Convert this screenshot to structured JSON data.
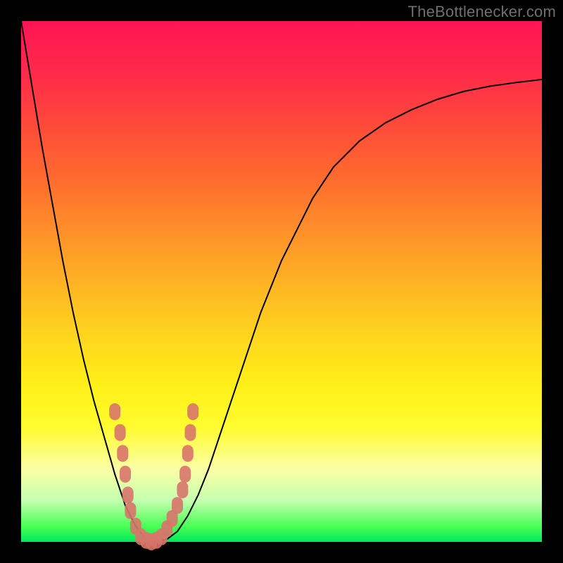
{
  "watermark": "TheBottlenecker.com",
  "colors": {
    "curve_stroke": "#000000",
    "node_fill": "#d8746a",
    "node_fill_alpha": 0.9
  },
  "chart_data": {
    "type": "line",
    "title": "",
    "xlabel": "",
    "ylabel": "",
    "xlim": [
      0,
      100
    ],
    "ylim": [
      0,
      100
    ],
    "x": [
      0,
      2,
      4,
      6,
      8,
      10,
      12,
      14,
      16,
      18,
      20,
      22,
      24,
      26,
      28,
      30,
      32,
      34,
      36,
      38,
      40,
      42,
      44,
      46,
      48,
      50,
      52,
      54,
      56,
      58,
      60,
      65,
      70,
      75,
      80,
      85,
      90,
      95,
      100
    ],
    "y": [
      100,
      88,
      76,
      65,
      54,
      44,
      35,
      27,
      20,
      13,
      7,
      3,
      0.5,
      0,
      0.5,
      2,
      5,
      9,
      14,
      20,
      26,
      32,
      38,
      44,
      49,
      54,
      58,
      62,
      66,
      69,
      72,
      77,
      80.5,
      83,
      85,
      86.5,
      87.5,
      88.2,
      88.8
    ],
    "annotated_nodes": [
      {
        "x": 18,
        "y": 25
      },
      {
        "x": 19,
        "y": 21
      },
      {
        "x": 19.5,
        "y": 17
      },
      {
        "x": 20,
        "y": 13
      },
      {
        "x": 20.5,
        "y": 9
      },
      {
        "x": 21,
        "y": 6
      },
      {
        "x": 22,
        "y": 3
      },
      {
        "x": 23,
        "y": 1
      },
      {
        "x": 24,
        "y": 0.3
      },
      {
        "x": 25,
        "y": 0
      },
      {
        "x": 26,
        "y": 0.3
      },
      {
        "x": 27,
        "y": 1
      },
      {
        "x": 28,
        "y": 2.5
      },
      {
        "x": 29,
        "y": 4.5
      },
      {
        "x": 30,
        "y": 7
      },
      {
        "x": 31,
        "y": 10
      },
      {
        "x": 31.5,
        "y": 13
      },
      {
        "x": 32,
        "y": 17
      },
      {
        "x": 32.5,
        "y": 21
      },
      {
        "x": 33,
        "y": 25
      }
    ]
  }
}
